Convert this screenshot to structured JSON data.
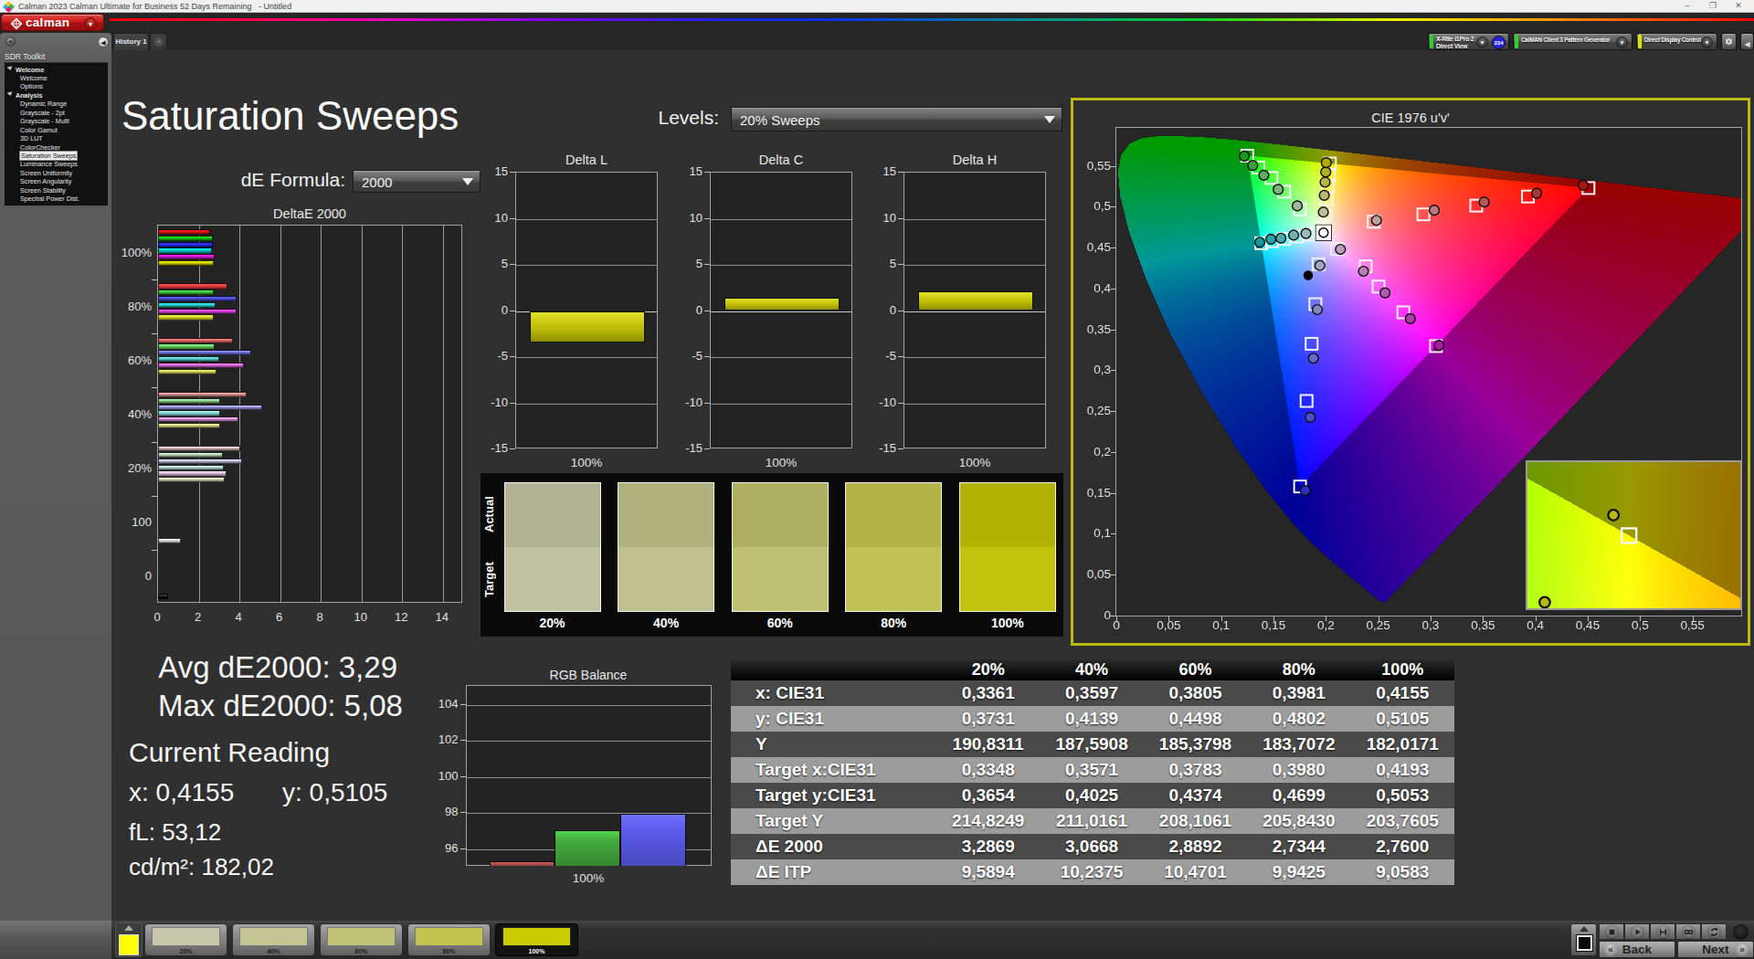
{
  "window": {
    "title": "Calman 2023 Calman Ultimate for Business 52 Days Remaining   - Untitled",
    "controls": {
      "minimize": "–",
      "restore": "❐",
      "close": "✕"
    }
  },
  "topbar": {
    "logo_text": "calman"
  },
  "device_bar": {
    "meter": {
      "line1": "X-Rite i1Pro 2",
      "line2": "Direct View",
      "status_color": "#27d427",
      "badge": "234",
      "badge_color": "#2323e0"
    },
    "pattern_generator": {
      "label": "CalMAN Client 3 Pattern Generator",
      "status_color": "#27d427"
    },
    "display_control": {
      "label": "Direct Display Control",
      "status_color": "#e0e000"
    }
  },
  "tabs": {
    "active": "History 1",
    "add_label": "+"
  },
  "sidebar": {
    "title": "SDR Toolkit",
    "tree": [
      {
        "label": "Welcome",
        "type": "group"
      },
      {
        "label": "Welcome",
        "type": "item"
      },
      {
        "label": "Options",
        "type": "item"
      },
      {
        "label": "Analysis",
        "type": "group"
      },
      {
        "label": "Dynamic Range",
        "type": "item"
      },
      {
        "label": "Grayscale - 2pt",
        "type": "item"
      },
      {
        "label": "Grayscale - Multi",
        "type": "item"
      },
      {
        "label": "Color Gamut",
        "type": "item"
      },
      {
        "label": "3D LUT",
        "type": "item"
      },
      {
        "label": "ColorChecker",
        "type": "item"
      },
      {
        "label": "Saturation Sweeps",
        "type": "item",
        "selected": true
      },
      {
        "label": "Luminance Sweeps",
        "type": "item"
      },
      {
        "label": "Screen Uniformity",
        "type": "item"
      },
      {
        "label": "Screen Angularity",
        "type": "item"
      },
      {
        "label": "Screen Stability",
        "type": "item"
      },
      {
        "label": "Spectral Power Dist.",
        "type": "item"
      }
    ]
  },
  "page": {
    "title": "Saturation Sweeps",
    "levels_label": "Levels:",
    "levels_value": "20% Sweeps",
    "de_formula_label": "dE Formula:",
    "de_formula_value": "2000"
  },
  "readings": {
    "avg_label": "Avg dE2000:",
    "avg_value": "3,29",
    "max_label": "Max dE2000:",
    "max_value": "5,08",
    "current_title": "Current Reading",
    "x_label": "x:",
    "x_value": "0,4155",
    "y_label": "y:",
    "y_value": "0,5105",
    "fl_label": "fL:",
    "fl_value": "53,12",
    "cd_label": "cd/m²:",
    "cd_value": "182,02"
  },
  "chart_data": [
    {
      "id": "deltae2000",
      "type": "bar",
      "title": "DeltaE 2000",
      "orientation": "horizontal",
      "xlim": [
        0,
        15
      ],
      "x_ticks": [
        0,
        2,
        4,
        6,
        8,
        10,
        12,
        14
      ],
      "group_labels": [
        "100%",
        "80%",
        "60%",
        "40%",
        "20%",
        "100",
        "0"
      ],
      "series_order": [
        "red",
        "green",
        "blue",
        "cyan",
        "magenta",
        "yellow"
      ],
      "series_colors": {
        "red": "#e01414",
        "green": "#14c014",
        "blue": "#2828e8",
        "cyan": "#00c4c4",
        "magenta": "#d418d4",
        "yellow": "#d0d000"
      },
      "groups": {
        "100%": [
          2.57,
          2.69,
          2.69,
          2.63,
          2.77,
          2.76
        ],
        "80%": [
          3.43,
          2.73,
          3.87,
          2.83,
          3.85,
          2.73
        ],
        "60%": [
          3.68,
          2.79,
          4.57,
          3.02,
          4.2,
          2.89
        ],
        "40%": [
          4.37,
          3.04,
          5.11,
          3.06,
          3.97,
          3.07
        ],
        "20%": [
          4.03,
          3.21,
          4.14,
          3.25,
          3.39,
          3.29
        ]
      },
      "white_bar": {
        "label": "100",
        "value": 1.14,
        "color": "#ececec"
      },
      "black_bar": {
        "label": "0",
        "value": 0.5,
        "color": "#1c1c1c"
      }
    },
    {
      "id": "delta_small",
      "type": "bar",
      "titles": [
        "Delta L",
        "Delta C",
        "Delta H"
      ],
      "values": [
        -3.4,
        1.4,
        2.14
      ],
      "bar_color": "#c8c800",
      "ylim": [
        -15,
        15
      ],
      "y_ticks": [
        15,
        10,
        5,
        0,
        -5,
        -10,
        -15
      ],
      "xlabel": "100%"
    },
    {
      "id": "swatches",
      "type": "table",
      "row_labels": [
        "Actual",
        "Target"
      ],
      "levels": [
        "20%",
        "40%",
        "60%",
        "80%",
        "100%"
      ],
      "actual_colors": [
        "#b1b392",
        "#b0b27e",
        "#afb162",
        "#b3b445",
        "#b1b201"
      ],
      "target_colors": [
        "#c0c1a3",
        "#bfc08e",
        "#bfc071",
        "#c1c256",
        "#c0c20c"
      ]
    },
    {
      "id": "rgb_balance",
      "type": "bar",
      "title": "RGB Balance",
      "categories": [
        "Red",
        "Green",
        "Blue"
      ],
      "values": [
        95.33,
        97.07,
        97.98
      ],
      "colors": [
        "#b85050",
        "#44a93e",
        "#5b5bec"
      ],
      "ylim": [
        95.07,
        105.07
      ],
      "y_ticks": [
        104,
        102,
        100,
        98,
        96
      ],
      "xlabel": "100%"
    },
    {
      "id": "cie1976",
      "type": "scatter",
      "title": "CIE 1976 u'v'",
      "xlim": [
        0,
        0.5965
      ],
      "ylim": [
        0,
        0.5965
      ],
      "x_ticks": [
        "0",
        "0,05",
        "0,1",
        "0,15",
        "0,2",
        "0,25",
        "0,3",
        "0,35",
        "0,4",
        "0,45",
        "0,5",
        "0,55"
      ],
      "y_ticks": [
        "0",
        "0,05",
        "0,1",
        "0,15",
        "0,2",
        "0,25",
        "0,3",
        "0,35",
        "0,4",
        "0,45",
        "0,5",
        "0,55"
      ],
      "tick_step": 0.05,
      "spectral_locus_uv": [
        [
          0.2569,
          0.0165
        ],
        [
          0.2522,
          0.0169
        ],
        [
          0.2348,
          0.0349
        ],
        [
          0.2161,
          0.055
        ],
        [
          0.2033,
          0.0689
        ],
        [
          0.1877,
          0.0871
        ],
        [
          0.169,
          0.1119
        ],
        [
          0.1441,
          0.151
        ],
        [
          0.1147,
          0.2044
        ],
        [
          0.0828,
          0.2708
        ],
        [
          0.0521,
          0.3427
        ],
        [
          0.0282,
          0.4117
        ],
        [
          0.0119,
          0.4698
        ],
        [
          0.0035,
          0.5131
        ],
        [
          0.0014,
          0.5432
        ],
        [
          0.0046,
          0.5638
        ],
        [
          0.0123,
          0.577
        ],
        [
          0.0231,
          0.5837
        ],
        [
          0.036,
          0.5861
        ],
        [
          0.0501,
          0.5868
        ],
        [
          0.0792,
          0.5856
        ],
        [
          0.1127,
          0.5821
        ],
        [
          0.1531,
          0.5766
        ],
        [
          0.2026,
          0.5694
        ],
        [
          0.2623,
          0.5604
        ],
        [
          0.3315,
          0.5501
        ],
        [
          0.4035,
          0.5393
        ],
        [
          0.4691,
          0.5296
        ],
        [
          0.5202,
          0.5219
        ],
        [
          0.5709,
          0.5144
        ],
        [
          0.6005,
          0.5099
        ],
        [
          0.6234,
          0.5065
        ]
      ],
      "rec709_triangle_uv": [
        [
          0.4507,
          0.5229
        ],
        [
          0.125,
          0.5625
        ],
        [
          0.1754,
          0.1579
        ]
      ],
      "outside_gamut_dim": 0.6,
      "white_point": [
        0.1978,
        0.4683
      ],
      "black_dot": [
        0.1831,
        0.4161
      ],
      "sweeps": {
        "green": {
          "patch_base": [
            30,
            185,
            30
          ],
          "targets": [
            [
              0.1753,
              0.4967
            ],
            [
              0.1602,
              0.5185
            ],
            [
              0.1481,
              0.5352
            ],
            [
              0.1356,
              0.548
            ],
            [
              0.125,
              0.5625
            ]
          ],
          "measured": [
            [
              0.1727,
              0.5011
            ],
            [
              0.1545,
              0.5212
            ],
            [
              0.1408,
              0.5386
            ],
            [
              0.1302,
              0.5506
            ],
            [
              0.1222,
              0.562
            ]
          ]
        },
        "cyan": {
          "patch_base": [
            0,
            185,
            185
          ],
          "targets": [
            [
              0.1843,
              0.466
            ],
            [
              0.1724,
              0.4636
            ],
            [
              0.1602,
              0.4606
            ],
            [
              0.1486,
              0.4579
            ],
            [
              0.1383,
              0.4554
            ]
          ],
          "measured": [
            [
              0.181,
              0.4673
            ],
            [
              0.1693,
              0.4653
            ],
            [
              0.1571,
              0.4616
            ],
            [
              0.1475,
              0.4603
            ],
            [
              0.1369,
              0.4566
            ]
          ]
        },
        "yellow": {
          "patch_base": [
            205,
            205,
            0
          ],
          "targets": [
            [
              0.1994,
              0.4897
            ],
            [
              0.2007,
              0.5091
            ],
            [
              0.202,
              0.5254
            ],
            [
              0.203,
              0.5392
            ],
            [
              0.2039,
              0.5529
            ]
          ],
          "measured": [
            [
              0.1976,
              0.4935
            ],
            [
              0.1985,
              0.514
            ],
            [
              0.1993,
              0.5301
            ],
            [
              0.1999,
              0.5425
            ],
            [
              0.2004,
              0.5539
            ]
          ]
        },
        "red": {
          "patch_base": [
            200,
            25,
            25
          ],
          "targets": [
            [
              0.2457,
              0.4817
            ],
            [
              0.2931,
              0.4907
            ],
            [
              0.3436,
              0.5014
            ],
            [
              0.3929,
              0.5125
            ],
            [
              0.4507,
              0.5229
            ]
          ],
          "measured": [
            [
              0.2483,
              0.4834
            ],
            [
              0.3035,
              0.4958
            ],
            [
              0.3511,
              0.5058
            ],
            [
              0.4012,
              0.5165
            ],
            [
              0.4457,
              0.5262
            ]
          ]
        },
        "magenta": {
          "patch_base": [
            200,
            30,
            195
          ],
          "targets": [
            [
              0.2108,
              0.4482
            ],
            [
              0.238,
              0.4271
            ],
            [
              0.2503,
              0.4024
            ],
            [
              0.274,
              0.3709
            ],
            [
              0.3051,
              0.3296
            ]
          ],
          "measured": [
            [
              0.2139,
              0.4479
            ],
            [
              0.2359,
              0.4211
            ],
            [
              0.2565,
              0.3947
            ],
            [
              0.2806,
              0.3632
            ],
            [
              0.308,
              0.3304
            ]
          ]
        },
        "blue": {
          "patch_base": [
            55,
            55,
            235
          ],
          "targets": [
            [
              0.193,
              0.4298
            ],
            [
              0.19,
              0.3809
            ],
            [
              0.1864,
              0.3324
            ],
            [
              0.1816,
              0.2625
            ],
            [
              0.1754,
              0.1579
            ]
          ],
          "measured": [
            [
              0.1943,
              0.4281
            ],
            [
              0.1919,
              0.3742
            ],
            [
              0.1881,
              0.3147
            ],
            [
              0.1851,
              0.2425
            ],
            [
              0.1803,
              0.153
            ]
          ]
        }
      },
      "inset": {
        "viewport_u": [
          0.181,
          0.229
        ],
        "viewport_v": [
          0.54936,
          0.55648
        ],
        "markers": [
          {
            "kind": "circle",
            "uv": [
              0.2004,
              0.5539
            ]
          },
          {
            "kind": "square",
            "uv": [
              0.2039,
              0.5529
            ]
          },
          {
            "kind": "circle",
            "uv": [
              0.1849,
              0.54965
            ]
          }
        ]
      }
    },
    {
      "id": "results_table",
      "type": "table",
      "columns": [
        "",
        "20%",
        "40%",
        "60%",
        "80%",
        "100%"
      ],
      "rows": [
        {
          "label": "x: CIE31",
          "values": [
            "0,3361",
            "0,3597",
            "0,3805",
            "0,3981",
            "0,4155"
          ]
        },
        {
          "label": "y: CIE31",
          "values": [
            "0,3731",
            "0,4139",
            "0,4498",
            "0,4802",
            "0,5105"
          ]
        },
        {
          "label": "Y",
          "values": [
            "190,8311",
            "187,5908",
            "185,3798",
            "183,7072",
            "182,0171"
          ]
        },
        {
          "label": "Target x:CIE31",
          "values": [
            "0,3348",
            "0,3571",
            "0,3783",
            "0,3980",
            "0,4193"
          ]
        },
        {
          "label": "Target y:CIE31",
          "values": [
            "0,3654",
            "0,4025",
            "0,4374",
            "0,4699",
            "0,5053"
          ]
        },
        {
          "label": "Target Y",
          "values": [
            "214,8249",
            "211,0161",
            "208,1061",
            "205,8430",
            "203,7605"
          ]
        },
        {
          "label": "ΔE 2000",
          "values": [
            "3,2869",
            "3,0668",
            "2,8892",
            "2,7344",
            "2,7600"
          ]
        },
        {
          "label": "ΔE ITP",
          "values": [
            "9,5894",
            "10,2375",
            "10,4701",
            "9,9425",
            "9,0583"
          ]
        }
      ]
    }
  ],
  "pattern_bar": {
    "current_swatch_color": "#ffff00",
    "thumbs": [
      {
        "label": "20%",
        "color": "#c6c7ab",
        "selected": false
      },
      {
        "label": "40%",
        "color": "#c4c593",
        "selected": false
      },
      {
        "label": "60%",
        "color": "#c2c276",
        "selected": false
      },
      {
        "label": "80%",
        "color": "#c3c352",
        "selected": false
      },
      {
        "label": "100%",
        "color": "#cbcc00",
        "selected": true
      }
    ],
    "transport": [
      "stop",
      "play",
      "step",
      "loop",
      "refresh"
    ],
    "back_label": "Back",
    "next_label": "Next"
  }
}
